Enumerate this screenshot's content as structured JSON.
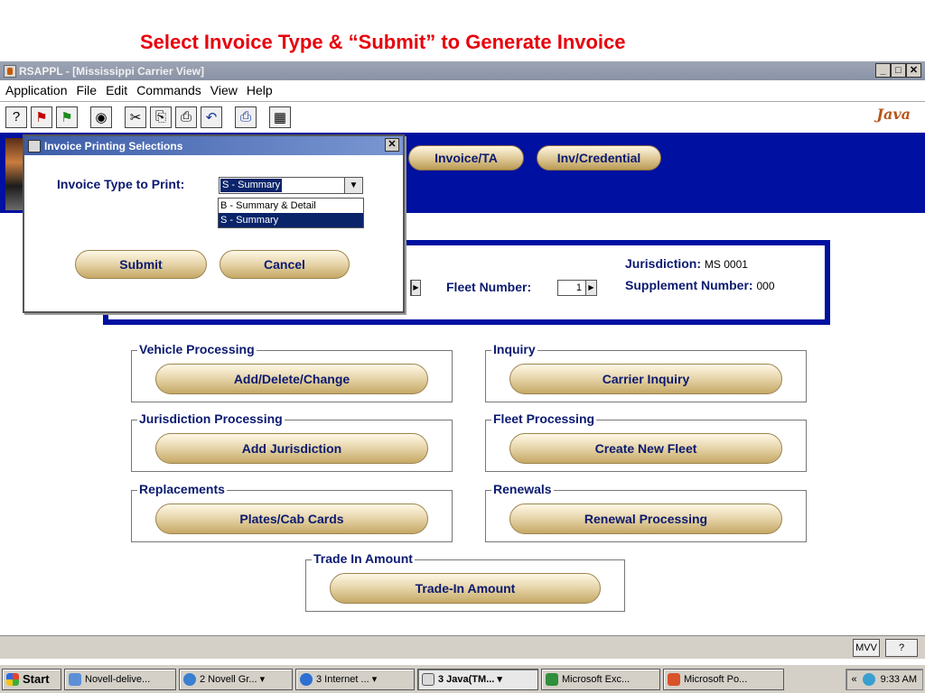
{
  "headline": "Select Invoice Type & “Submit” to Generate Invoice",
  "window": {
    "title": "RSAPPL - [Mississippi Carrier View]",
    "controls": [
      "_",
      "□",
      "✕"
    ]
  },
  "menu": [
    "Application",
    "File",
    "Edit",
    "Commands",
    "View",
    "Help"
  ],
  "toolbar": {
    "icons": [
      "help-icon",
      "flag-red-icon",
      "flag-green-icon",
      "view-icon",
      "cut-icon",
      "copy-icon",
      "paste-icon",
      "undo-icon",
      "print-icon",
      "calculator-icon"
    ],
    "glyphs": [
      "?",
      "⚑",
      "⚑",
      "◉",
      "✂",
      "⎘",
      "⎙",
      "↶",
      "⎙",
      "▦"
    ],
    "logo": "Java"
  },
  "banner": {
    "buttons": [
      "Invoice/TA",
      "Inv/Credential"
    ]
  },
  "info": {
    "jurisdiction_label": "Jurisdiction:",
    "jurisdiction_value": "MS 0001",
    "fleet_label": "Fleet Number:",
    "fleet_value": "1",
    "supplement_label": "Supplement Number:",
    "supplement_value": "000"
  },
  "groups": [
    {
      "title": "Vehicle Processing",
      "button": "Add/Delete/Change"
    },
    {
      "title": "Inquiry",
      "button": "Carrier Inquiry"
    },
    {
      "title": "Jurisdiction Processing",
      "button": "Add Jurisdiction"
    },
    {
      "title": "Fleet Processing",
      "button": "Create New Fleet"
    },
    {
      "title": "Replacements",
      "button": "Plates/Cab Cards"
    },
    {
      "title": "Renewals",
      "button": "Renewal Processing"
    },
    {
      "title": "Trade In Amount",
      "button": "Trade-In Amount"
    }
  ],
  "dialog": {
    "title": "Invoice Printing Selections",
    "close": "✕",
    "type_label": "Invoice Type to Print:",
    "selected": "S - Summary",
    "options": [
      "B - Summary & Detail",
      "S - Summary"
    ],
    "highlighted_option": "S - Summary",
    "submit": "Submit",
    "cancel": "Cancel"
  },
  "statusbar": {
    "buttons": [
      "MVV",
      "?"
    ]
  },
  "taskbar": {
    "start": "Start",
    "tasks": [
      "Novell-delive...",
      "2 Novell Gr... ▾",
      "3 Internet ... ▾",
      "3 Java(TM... ▾",
      "Microsoft Exc...",
      "Microsoft Po..."
    ],
    "tray_arrow": "«",
    "clock": "9:33 AM"
  },
  "colors": {
    "headline": "#e8000b",
    "banner": "#0010a0",
    "label_text": "#0b1a70",
    "selection": "#0a246a"
  }
}
